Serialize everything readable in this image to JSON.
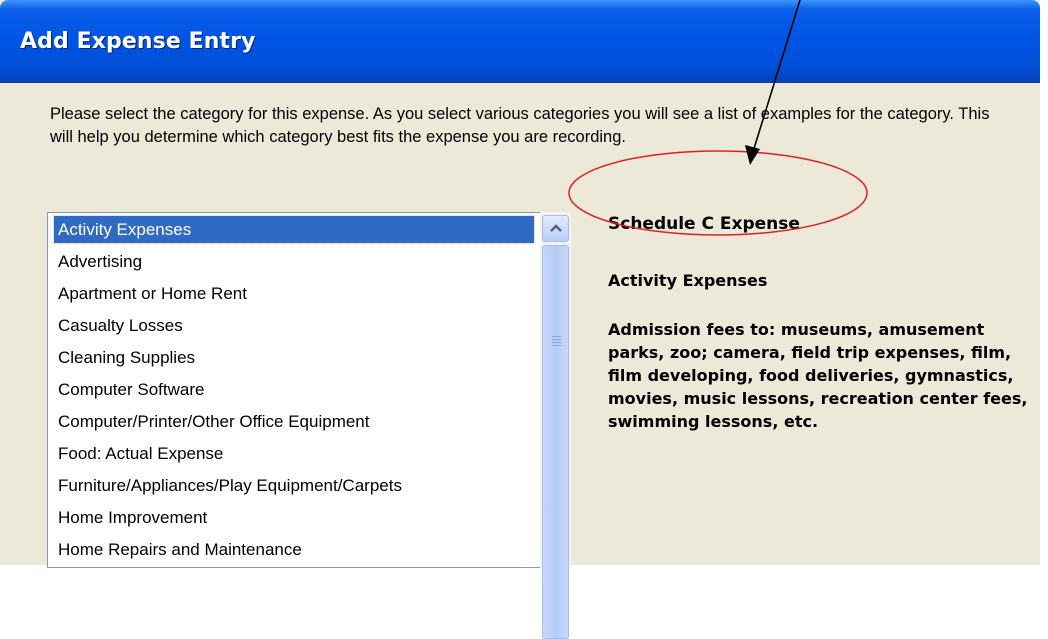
{
  "window": {
    "title": "Add Expense Entry"
  },
  "instructions": "Please select the category for this expense. As you select various categories you will see a list of examples for the category. This will help you determine which category best fits the expense you are recording.",
  "category_list": {
    "items": [
      {
        "label": "Activity Expenses",
        "selected": true
      },
      {
        "label": "Advertising"
      },
      {
        "label": "Apartment or Home Rent"
      },
      {
        "label": "Casualty Losses"
      },
      {
        "label": "Cleaning Supplies"
      },
      {
        "label": "Computer Software"
      },
      {
        "label": "Computer/Printer/Other Office Equipment"
      },
      {
        "label": "Food: Actual Expense"
      },
      {
        "label": "Furniture/Appliances/Play Equipment/Carpets"
      },
      {
        "label": "Home Improvement"
      },
      {
        "label": "Home Repairs and Maintenance"
      }
    ]
  },
  "details": {
    "schedule_label": "Schedule C Expense",
    "category_name": "Activity Expenses",
    "examples": "Admission fees to: museums, amusement parks, zoo; camera, field trip expenses, film, film developing, food deliveries, gymnastics, movies, music lessons, recreation center fees, swimming lessons, etc."
  },
  "colors": {
    "titlebar": "#0055e5",
    "selection": "#316ac5",
    "dialog_background": "#ece9d8",
    "annotation_ellipse": "#e02020"
  }
}
